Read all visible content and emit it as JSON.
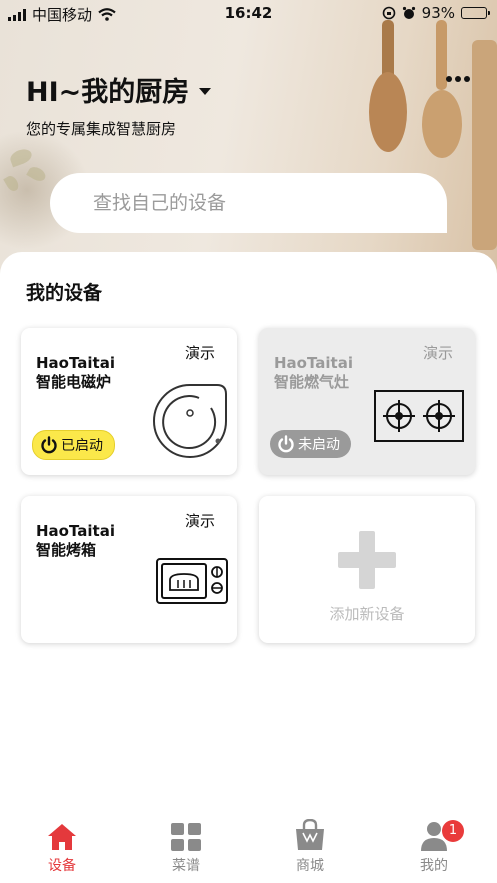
{
  "status_bar": {
    "carrier": "中国移动",
    "time": "16:42",
    "battery": "93%",
    "battery_level": 0.93
  },
  "header": {
    "title": "HI~我的厨房",
    "subtitle": "您的专属集成智慧厨房"
  },
  "search": {
    "placeholder": "查找自己的设备"
  },
  "section": {
    "title": "我的设备"
  },
  "devices": [
    {
      "brand": "HaoTaitai",
      "name": "智能电磁炉",
      "demo": "演示",
      "status": "已启动",
      "state": "on",
      "icon": "induction-cooker-icon"
    },
    {
      "brand": "HaoTaitai",
      "name": "智能燃气灶",
      "demo": "演示",
      "status": "未启动",
      "state": "off",
      "icon": "gas-stove-icon"
    },
    {
      "brand": "HaoTaitai",
      "name": "智能烤箱",
      "demo": "演示",
      "icon": "oven-icon"
    }
  ],
  "add_device": {
    "label": "添加新设备",
    "icon": "plus-icon"
  },
  "tabbar": {
    "items": [
      {
        "label": "设备",
        "icon": "home-icon",
        "active": true
      },
      {
        "label": "菜谱",
        "icon": "grid-icon",
        "active": false
      },
      {
        "label": "商城",
        "icon": "shopping-bag-icon",
        "active": false
      },
      {
        "label": "我的",
        "icon": "user-icon",
        "active": false,
        "badge": "1"
      }
    ]
  },
  "colors": {
    "accent_red": "#e4393c",
    "status_on_yellow": "#fbe84a",
    "status_off_gray": "#9a9a9a"
  }
}
